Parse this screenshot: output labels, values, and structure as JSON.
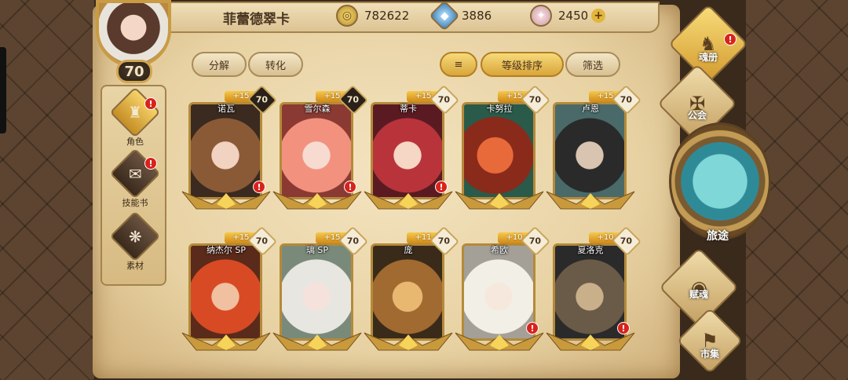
{
  "player": {
    "name": "菲蕾德翠卡",
    "level": "70"
  },
  "currencies": [
    {
      "icon": "gold-coin-icon",
      "value": "782622"
    },
    {
      "icon": "blue-crystal-icon",
      "value": "3886"
    },
    {
      "icon": "pink-stone-icon",
      "value": "2450"
    }
  ],
  "actions": {
    "decompose": "分解",
    "convert": "转化",
    "sort_icon": "≡",
    "sort_level": "等级排序",
    "filter": "筛选"
  },
  "leftnav": [
    {
      "label": "角色",
      "icon": "helmet-icon",
      "alert": "!"
    },
    {
      "label": "技能书",
      "icon": "skill-book-icon",
      "alert": "!"
    },
    {
      "label": "素材",
      "icon": "material-icon",
      "alert": ""
    }
  ],
  "heroes": [
    {
      "name": "诺瓦",
      "plus": "+15",
      "level": "70",
      "alert": "!"
    },
    {
      "name": "雪尔森",
      "plus": "+15",
      "level": "70",
      "alert": "!"
    },
    {
      "name": "蒂卡",
      "plus": "+15",
      "level": "70",
      "alert": "!"
    },
    {
      "name": "卡努拉",
      "plus": "+15",
      "level": "70",
      "alert": ""
    },
    {
      "name": "卢恩",
      "plus": "+15",
      "level": "70",
      "alert": ""
    },
    {
      "name": "纳杰尔 SP",
      "plus": "+15",
      "level": "70",
      "alert": ""
    },
    {
      "name": "璃 SP",
      "plus": "+15",
      "level": "70",
      "alert": ""
    },
    {
      "name": "庞",
      "plus": "+11",
      "level": "70",
      "alert": ""
    },
    {
      "name": "希欧",
      "plus": "+10",
      "level": "70",
      "alert": "!"
    },
    {
      "name": "夏洛克",
      "plus": "+10",
      "level": "70",
      "alert": "!"
    }
  ],
  "rightnav": {
    "soulbook": "魂册",
    "guild": "公会",
    "journey": "旅途",
    "talent": "赋魂",
    "market": "市集"
  },
  "colors": {
    "accent_gold": "#d9a53a",
    "alert_red": "#d8231c",
    "parchment": "#e8d2a3"
  }
}
